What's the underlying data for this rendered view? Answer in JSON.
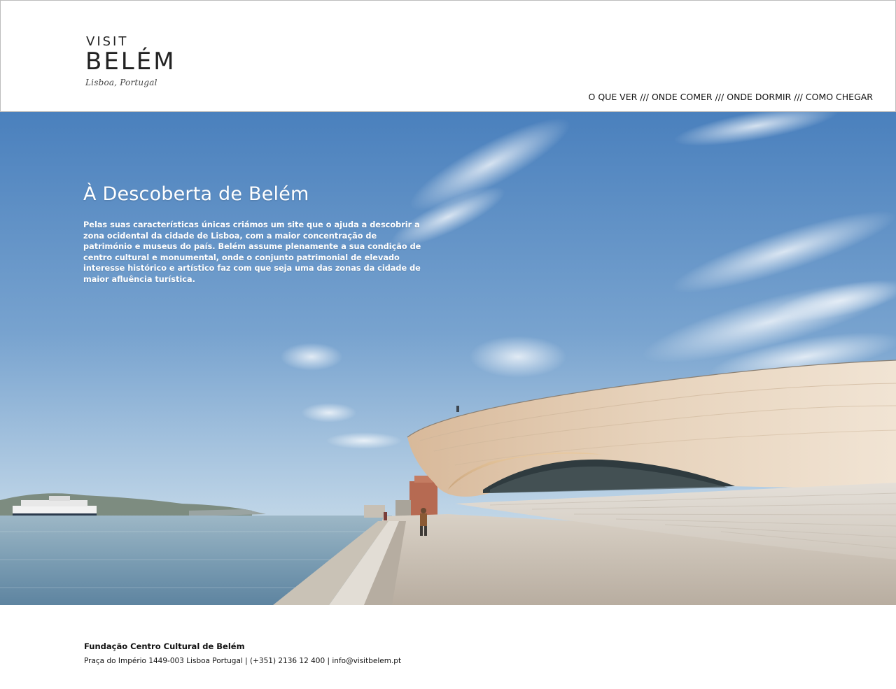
{
  "header": {
    "logo": {
      "visit": "VISIT",
      "belem": "BELÉM",
      "place": "Lisboa, Portugal"
    },
    "nav": {
      "items": [
        {
          "label": "O QUE VER"
        },
        {
          "label": "ONDE COMER"
        },
        {
          "label": "ONDE DORMIR"
        },
        {
          "label": "COMO CHEGAR"
        }
      ],
      "separator": "///"
    }
  },
  "hero": {
    "title": "À Descoberta de Belém",
    "body": "Pelas suas características únicas criámos um site que o ajuda a descobrir a zona ocidental da cidade de Lisboa, com a maior concentração de património e museus do país. Belém assume plenamente a sua condição de centro cultural e monumental, onde o conjunto patrimonial de elevado interesse histórico e artístico faz com que seja uma das zonas da cidade de maior afluência turística.",
    "image": "maat-museum-riverside-photo"
  },
  "footer": {
    "org": "Fundação Centro Cultural de Belém",
    "contact": "Praça do Império 1449-003 Lisboa Portugal | (+351) 2136 12 400 | info@visitbelem.pt"
  },
  "colors": {
    "sky_top": "#4f86c2",
    "sky_bottom": "#cfe0ee",
    "water": "#7a9eb5",
    "building": "#d9c2a6",
    "text_dark": "#111111"
  }
}
